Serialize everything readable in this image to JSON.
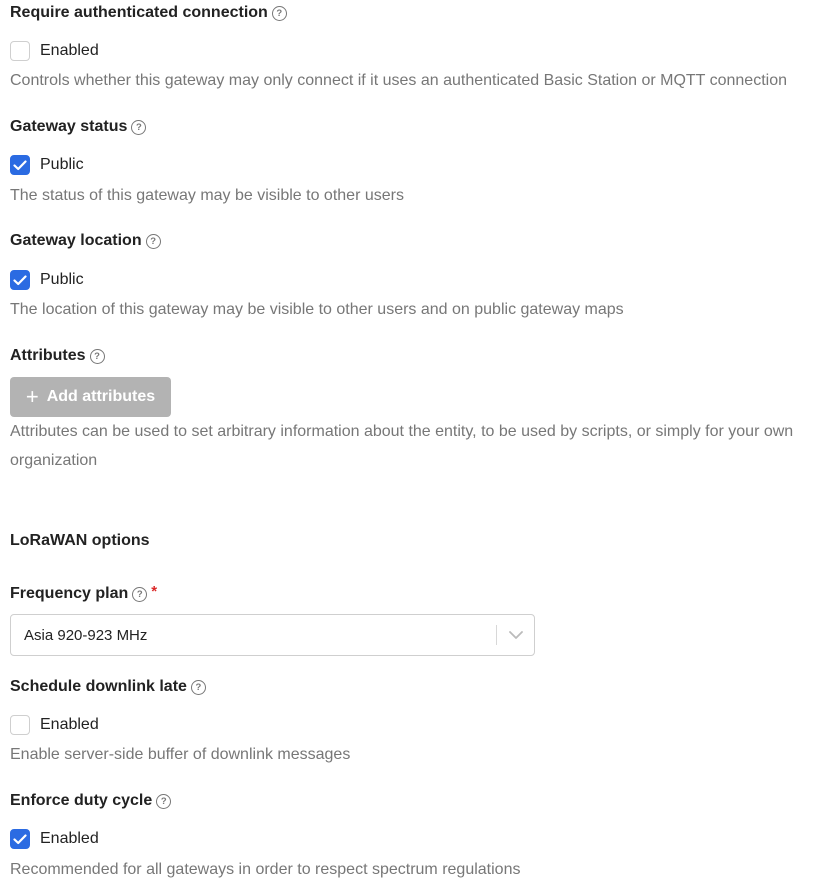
{
  "require_auth": {
    "label": "Require authenticated connection",
    "checkbox_label": "Enabled",
    "checked": false,
    "description": "Controls whether this gateway may only connect if it uses an authenticated Basic Station or MQTT connection"
  },
  "gateway_status": {
    "label": "Gateway status",
    "checkbox_label": "Public",
    "checked": true,
    "description": "The status of this gateway may be visible to other users"
  },
  "gateway_location": {
    "label": "Gateway location",
    "checkbox_label": "Public",
    "checked": true,
    "description": "The location of this gateway may be visible to other users and on public gateway maps"
  },
  "attributes": {
    "label": "Attributes",
    "button_label": "Add attributes",
    "description_line1": "Attributes can be used to set arbitrary information about the entity, to be used by scripts, or simply for your own",
    "description_line2": "organization"
  },
  "lorawan": {
    "section_title": "LoRaWAN options"
  },
  "frequency_plan": {
    "label": "Frequency plan",
    "required_mark": "*",
    "value": "Asia 920-923 MHz"
  },
  "schedule_downlink": {
    "label": "Schedule downlink late",
    "checkbox_label": "Enabled",
    "checked": false,
    "description": "Enable server-side buffer of downlink messages"
  },
  "duty_cycle": {
    "label": "Enforce duty cycle",
    "checkbox_label": "Enabled",
    "checked": true,
    "description": "Recommended for all gateways in order to respect spectrum regulations"
  },
  "icons": {
    "help": "question-circle-icon",
    "check": "checkmark-icon",
    "plus": "plus-icon",
    "dropdown": "chevron-down-icon"
  },
  "colors": {
    "checkbox_checked": "#2b6be2",
    "button_disabled": "#b3b3b3",
    "required": "#db2828",
    "description_text": "#777777"
  }
}
